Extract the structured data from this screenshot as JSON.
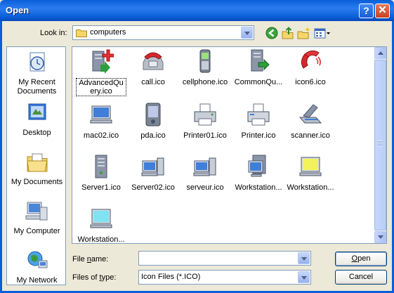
{
  "window": {
    "title": "Open",
    "help_label": "?",
    "close_label": "✕"
  },
  "toolbar": {
    "lookin_label": "Look in:",
    "lookin_value": "computers",
    "icons": [
      "back-icon",
      "up-folder-icon",
      "new-folder-icon",
      "views-menu-icon"
    ]
  },
  "places": [
    {
      "label": "My Recent Documents",
      "icon": "recent-documents-icon"
    },
    {
      "label": "Desktop",
      "icon": "desktop-icon"
    },
    {
      "label": "My Documents",
      "icon": "my-documents-icon"
    },
    {
      "label": "My Computer",
      "icon": "my-computer-icon"
    },
    {
      "label": "My Network",
      "icon": "my-network-icon"
    }
  ],
  "files": [
    {
      "name": "AdvancedQuery.ico",
      "icon": "server-add-icon",
      "selected": true
    },
    {
      "name": "call.ico",
      "icon": "phone-icon"
    },
    {
      "name": "cellphone.ico",
      "icon": "cellphone-icon"
    },
    {
      "name": "CommonQu...",
      "icon": "server-query-icon"
    },
    {
      "name": "icon6.ico",
      "icon": "handset-icon"
    },
    {
      "name": "mac02.ico",
      "icon": "monitor-icon"
    },
    {
      "name": "pda.ico",
      "icon": "pda-icon"
    },
    {
      "name": "Printer01.ico",
      "icon": "printer-icon"
    },
    {
      "name": "Printer.ico",
      "icon": "printer-icon"
    },
    {
      "name": "scanner.ico",
      "icon": "scanner-icon"
    },
    {
      "name": "Server1.ico",
      "icon": "server-tower-icon"
    },
    {
      "name": "Server02.ico",
      "icon": "desktop-computer-icon"
    },
    {
      "name": "serveur.ico",
      "icon": "desktop-computer-icon"
    },
    {
      "name": "Workstation...",
      "icon": "workstation-icon"
    },
    {
      "name": "Workstation...",
      "icon": "yellow-monitor-icon"
    },
    {
      "name": "Workstation...",
      "icon": "cyan-monitor-icon"
    }
  ],
  "form": {
    "filename_label_pre": "File ",
    "filename_label_u": "n",
    "filename_label_post": "ame:",
    "filename_value": "",
    "filetype_label_pre": "Files of ",
    "filetype_label_u": "t",
    "filetype_label_post": "ype:",
    "filetype_value": "Icon Files (*.ICO)",
    "open_label_u": "O",
    "open_label_post": "pen",
    "cancel_label": "Cancel"
  },
  "colors": {
    "titlebar": "#0A5FD8",
    "dialog_bg": "#ECE9D8",
    "border": "#7F9DB9"
  }
}
